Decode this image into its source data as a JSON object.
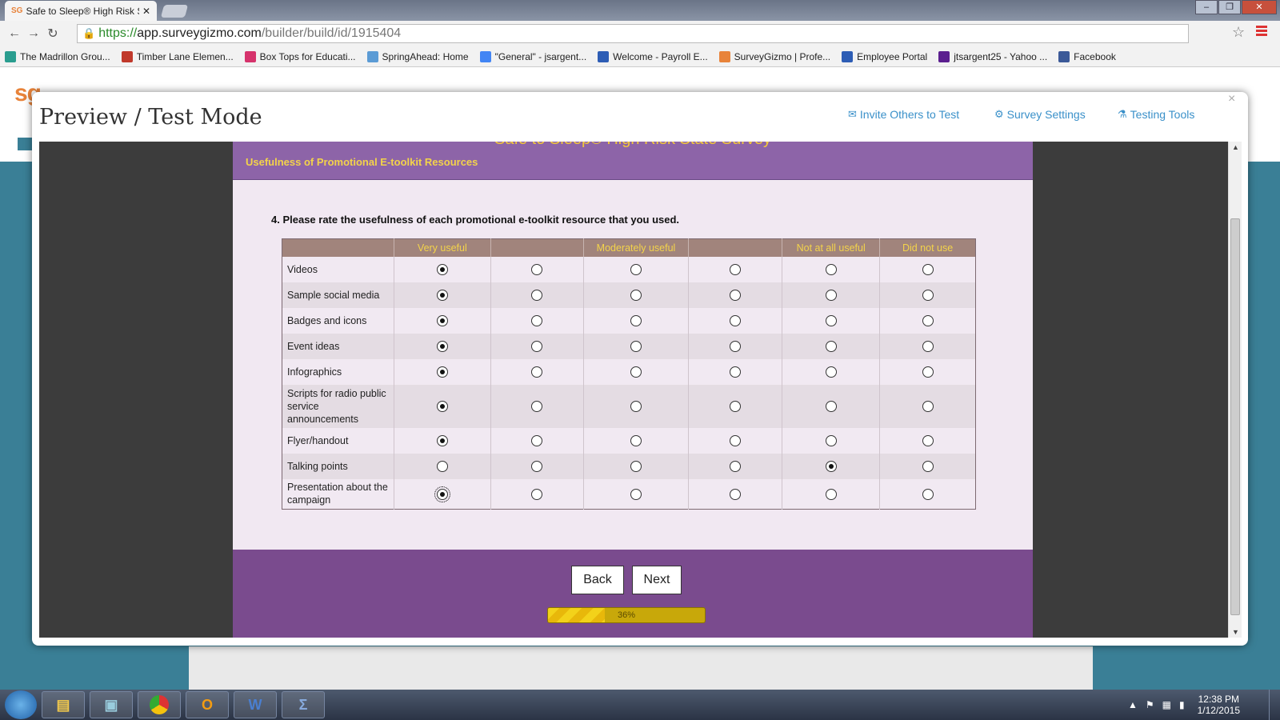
{
  "browser": {
    "tab_title": "Safe to Sleep® High Risk S",
    "tab_favicon": "SG",
    "url_scheme": "https://",
    "url_domain": "app.surveygizmo.com",
    "url_path": "/builder/build/id/1915404",
    "bookmarks": [
      {
        "label": "The Madrillon Grou...",
        "icon": "star-icon",
        "color": "#2a9d8f"
      },
      {
        "label": "Timber Lane Elemen...",
        "icon": "school-icon",
        "color": "#c0392b"
      },
      {
        "label": "Box Tops for Educati...",
        "icon": "folder-icon",
        "color": "#d6336c"
      },
      {
        "label": "SpringAhead: Home",
        "icon": "grid-icon",
        "color": "#5b9bd5"
      },
      {
        "label": "\"General\" - jsargent...",
        "icon": "google-icon",
        "color": "#4285f4"
      },
      {
        "label": "Welcome - Payroll E...",
        "icon": "p-icon",
        "color": "#2d5db5"
      },
      {
        "label": "SurveyGizmo | Profe...",
        "icon": "sg-icon",
        "color": "#e8833a"
      },
      {
        "label": "Employee Portal",
        "icon": "p-icon",
        "color": "#2d5db5"
      },
      {
        "label": "jtsargent25 - Yahoo ...",
        "icon": "mail-icon",
        "color": "#5b1f8f"
      },
      {
        "label": "Facebook",
        "icon": "facebook-icon",
        "color": "#3b5998"
      }
    ]
  },
  "modal": {
    "title": "Preview / Test Mode",
    "close": "×",
    "links": {
      "invite": "Invite Others to Test",
      "settings": "Survey Settings",
      "tools": "Testing Tools"
    }
  },
  "survey": {
    "title": "Safe to Sleep® High Risk State Survey",
    "page_title": "Usefulness of Promotional E-toolkit Resources",
    "question": "4. Please rate the usefulness of each promotional e-toolkit resource that you used.",
    "columns": [
      "Very useful",
      "",
      "Moderately useful",
      "",
      "Not at all useful",
      "Did not use"
    ],
    "rows": [
      {
        "label": "Videos",
        "selected": 0
      },
      {
        "label": "Sample social media",
        "selected": 0
      },
      {
        "label": "Badges and icons",
        "selected": 0
      },
      {
        "label": "Event ideas",
        "selected": 0
      },
      {
        "label": "Infographics",
        "selected": 0
      },
      {
        "label": "Scripts for radio public service announcements",
        "selected": 0
      },
      {
        "label": "Flyer/handout",
        "selected": 0
      },
      {
        "label": "Talking points",
        "selected": 4
      },
      {
        "label": "Presentation about the campaign",
        "selected": 0
      }
    ],
    "buttons": {
      "back": "Back",
      "next": "Next"
    },
    "progress": {
      "percent": 36,
      "label": "36%"
    }
  },
  "taskbar": {
    "time": "12:38 PM",
    "date": "1/12/2015",
    "apps": [
      "explorer-icon",
      "remote-desktop-icon",
      "chrome-icon",
      "outlook-icon",
      "word-icon",
      "calculator-icon"
    ]
  },
  "colors": {
    "survey_header": "#8d64a8",
    "survey_footer": "#7a4b8e",
    "grid_header": "#a1847c",
    "accent_text": "#f3d34a",
    "link": "#3a90c9"
  }
}
